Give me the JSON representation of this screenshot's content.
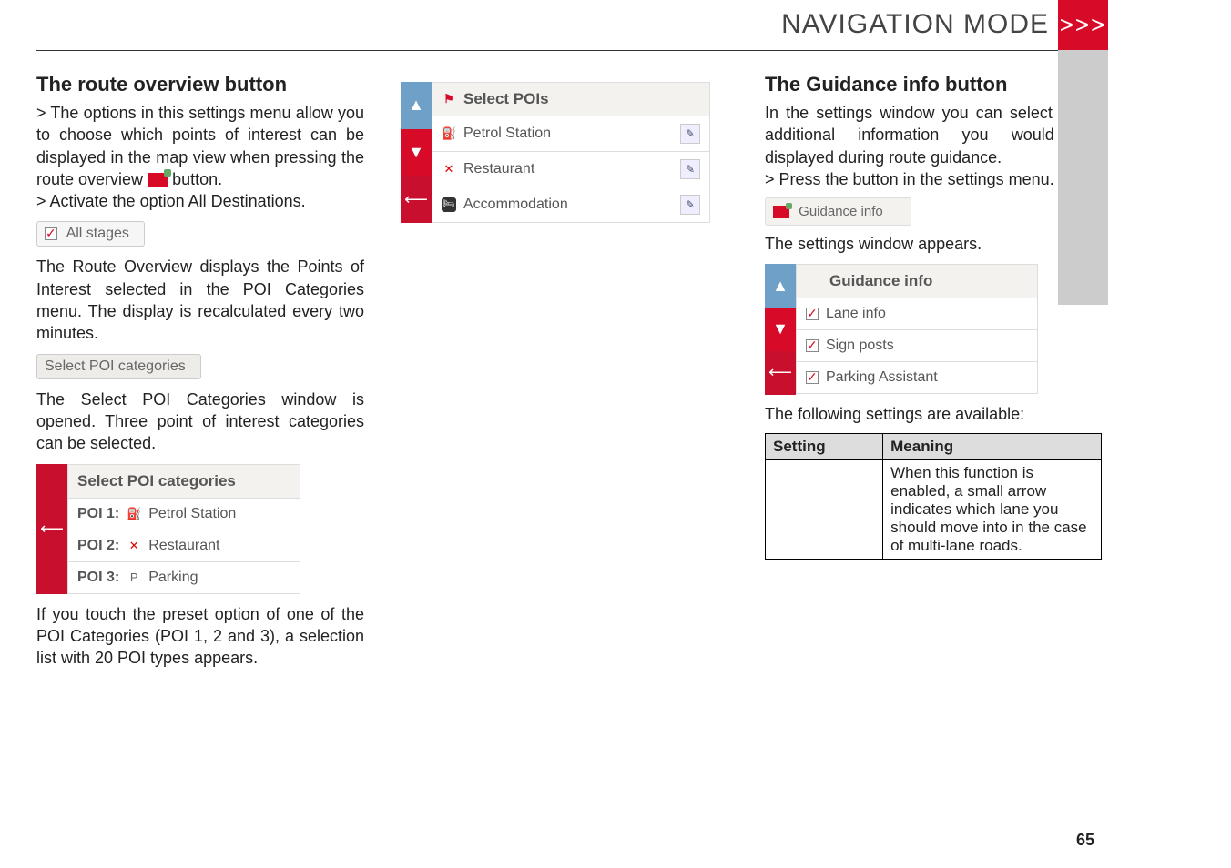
{
  "header": {
    "title": "NAVIGATION MODE",
    "chev": ">>>"
  },
  "col1": {
    "heading": "The route overview button",
    "p1_a": "> The options in this settings menu allow you to choose which points of interest can be displayed in the map view when pressing the route overview ",
    "p1_b": " button.",
    "p2": "> Activate the option All Destinations.",
    "chip1_label": "All stages",
    "p3": "The Route Overview displays the Points of Interest selected in the POI Categories menu. The display is recalculated every two minutes.",
    "chip2_label": "Select POI categories",
    "p4": "The Select POI Categories window is opened. Three point of interest categories can be selected.",
    "panel_title": "Select POI categories",
    "poi1_pre": "POI 1:",
    "poi1_label": "Petrol Station",
    "poi2_pre": "POI 2:",
    "poi2_label": "Restaurant",
    "poi3_pre": "POI 3:",
    "poi3_label": "Parking",
    "p5": "If you touch the preset option of one of the POI Categories (POI 1, 2 and 3), a selection list with 20 POI types appears."
  },
  "col2": {
    "panel_title": "Select POIs",
    "row1": "Petrol Station",
    "row2": "Restaurant",
    "row3": "Accommodation"
  },
  "col3": {
    "heading": "The Guidance info button",
    "p1": "In the settings window you can select which additional information you would like displayed during route guidance.",
    "p2": "> Press the button in the settings menu.",
    "chip_label": "Guidance info",
    "p3": "The settings window appears.",
    "panel_title": "Guidance info",
    "row1": "Lane info",
    "row2": "Sign posts",
    "row3": "Parking Assistant",
    "p4": "The following settings are available:",
    "th1": "Setting",
    "th2": "Meaning",
    "td2": "When this function is enabled, a small arrow indicates which lane you should move into in the case of multi-lane roads."
  },
  "page_number": "65"
}
